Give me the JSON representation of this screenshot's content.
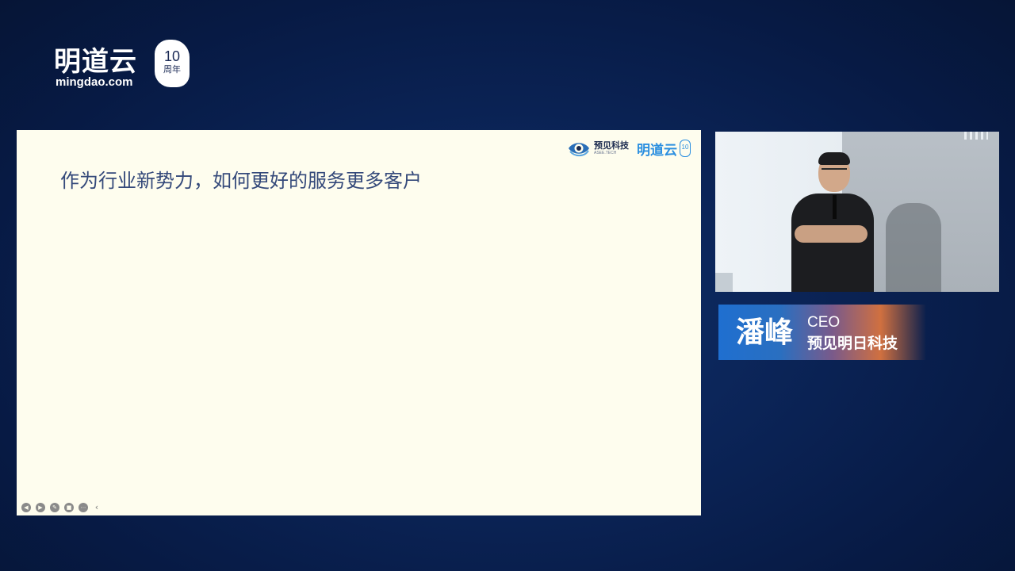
{
  "brand": {
    "name": "明道云",
    "domain": "mingdao.com",
    "anniversary_number": "10",
    "anniversary_text": "周年"
  },
  "slide": {
    "title": "作为行业新势力，如何更好的服务更多客户",
    "logos": {
      "partner_name": "预见科技",
      "partner_subtitle": "ASEE.TECH",
      "host_name": "明道云",
      "host_badge": "10"
    },
    "controls": [
      "prev-icon",
      "play-icon",
      "pen-icon",
      "camera-icon",
      "more-icon",
      "chevron-left-icon"
    ]
  },
  "speaker": {
    "name": "潘峰",
    "title": "CEO",
    "company": "预见明日科技"
  },
  "colors": {
    "background": "#0b2457",
    "slide_bg": "#fefdee",
    "slide_title": "#34497a",
    "brand_blue": "#2b8fe0",
    "banner_start": "#1f6fd0",
    "banner_end": "#d07040"
  }
}
